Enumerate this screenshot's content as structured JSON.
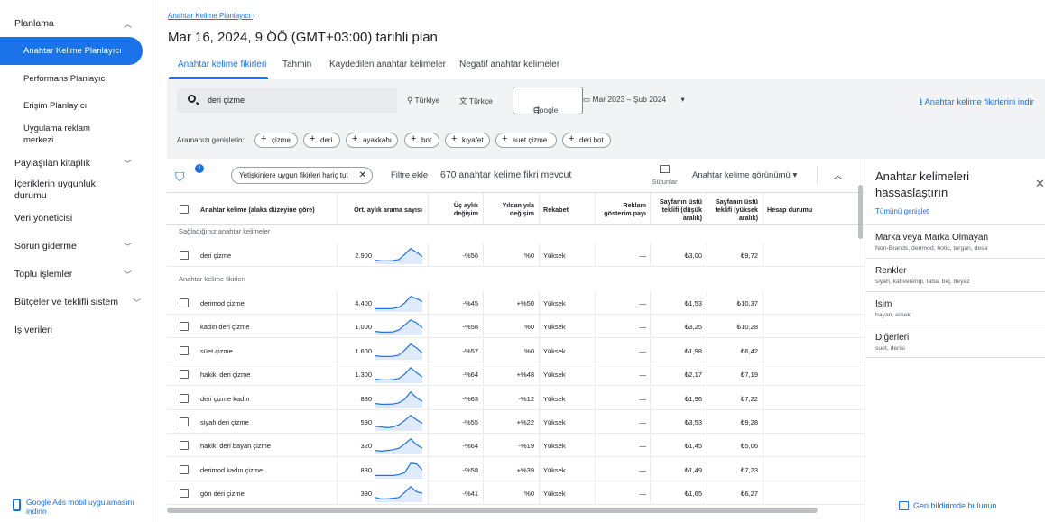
{
  "sidebar": {
    "planlama": "Planlama",
    "items": [
      {
        "label": "Anahtar Kelime Planlayıcı"
      },
      {
        "label": "Performans Planlayıcı"
      },
      {
        "label": "Erişim Planlayıcı"
      },
      {
        "label": "Uygulama reklam merkezi"
      }
    ],
    "groups": [
      {
        "label": "Paylaşılan kitaplık"
      },
      {
        "label": "İçeriklerin uygunluk durumu"
      },
      {
        "label": "Veri yöneticisi"
      },
      {
        "label": "Sorun giderme"
      },
      {
        "label": "Toplu işlemler"
      },
      {
        "label": "Bütçeler ve teklifli sistem"
      },
      {
        "label": "İş verileri"
      }
    ],
    "mobile_link": "Google Ads mobil uygulamasını indirin"
  },
  "header": {
    "breadcrumb": "Anahtar Kelime Planlayıcı",
    "breadcrumb_sep": "›",
    "title": "Mar 16, 2024, 9 ÖÖ (GMT+03:00) tarihli plan"
  },
  "tabs": [
    {
      "label": "Anahtar kelime fikirleri"
    },
    {
      "label": "Tahmin"
    },
    {
      "label": "Kaydedilen anahtar kelimeler"
    },
    {
      "label": "Negatif anahtar kelimeler"
    }
  ],
  "search": {
    "value": "deri çizme",
    "location": "Türkiye",
    "language": "Türkçe",
    "network": "Google",
    "date_range": "Mar 2023 – Şub 2024",
    "download": "Anahtar kelime fikirlerini indir"
  },
  "expand": {
    "label": "Aramanızı genişletin:",
    "chips": [
      "çizme",
      "deri",
      "ayakkabı",
      "bot",
      "kıyafet",
      "suet çizme",
      "deri bot"
    ]
  },
  "table_toolbar": {
    "filter_badge": "1",
    "adult_chip": "Yetişkinlere uygun fikirleri hariç tut",
    "add_filter": "Filtre ekle",
    "ideas_count": "670 anahtar kelime fikri mevcut",
    "columns": "Sütunlar",
    "view": "Anahtar kelime görünümü",
    "view_arrow": "▾"
  },
  "columns": {
    "keyword": "Anahtar kelime (alaka düzeyine göre)",
    "avg": "Ort. aylık arama sayısı",
    "three_month": "Üç aylık değişim",
    "yoy": "Yıldan yıla değişim",
    "competition": "Rekabet",
    "impr_share": "Reklam gösterim payı",
    "bid_low": "Sayfanın üstü teklifi (düşük aralık)",
    "bid_high": "Sayfanın üstü teklifi (yüksek aralık)",
    "account": "Hesap durumu"
  },
  "sections": {
    "provided": "Sağladığınız anahtar kelimeler",
    "ideas": "Anahtar kelime fikirleri"
  },
  "provided_rows": [
    {
      "keyword": "deri çizme",
      "avg": "2.900",
      "three_month": "-%56",
      "yoy": "%0",
      "competition": "Yüksek",
      "impr": "—",
      "low": "₺3,00",
      "high": "₺9,72",
      "trend": [
        0.15,
        0.1,
        0.1,
        0.12,
        0.2,
        0.55,
        0.95,
        0.7,
        0.4
      ]
    }
  ],
  "idea_rows": [
    {
      "keyword": "derimod çizme",
      "avg": "4.400",
      "three_month": "-%45",
      "yoy": "+%50",
      "competition": "Yüksek",
      "impr": "—",
      "low": "₺1,53",
      "high": "₺10,37",
      "trend": [
        0.1,
        0.1,
        0.1,
        0.12,
        0.2,
        0.5,
        0.95,
        0.8,
        0.6
      ]
    },
    {
      "keyword": "kadın deri çizme",
      "avg": "1.000",
      "three_month": "-%58",
      "yoy": "%0",
      "competition": "Yüksek",
      "impr": "—",
      "low": "₺3,25",
      "high": "₺10,28",
      "trend": [
        0.15,
        0.1,
        0.1,
        0.12,
        0.25,
        0.6,
        0.95,
        0.75,
        0.4
      ]
    },
    {
      "keyword": "süet çizme",
      "avg": "1.600",
      "three_month": "-%57",
      "yoy": "%0",
      "competition": "Yüksek",
      "impr": "—",
      "low": "₺1,98",
      "high": "₺6,42",
      "trend": [
        0.15,
        0.1,
        0.1,
        0.12,
        0.2,
        0.55,
        0.95,
        0.7,
        0.35
      ]
    },
    {
      "keyword": "hakiki deri çizme",
      "avg": "1.300",
      "three_month": "-%64",
      "yoy": "+%48",
      "competition": "Yüksek",
      "impr": "—",
      "low": "₺2,17",
      "high": "₺7,19",
      "trend": [
        0.15,
        0.1,
        0.1,
        0.12,
        0.2,
        0.5,
        0.95,
        0.6,
        0.3
      ]
    },
    {
      "keyword": "deri çizme kadın",
      "avg": "880",
      "three_month": "-%63",
      "yoy": "-%12",
      "competition": "Yüksek",
      "impr": "—",
      "low": "₺1,96",
      "high": "₺7,22",
      "trend": [
        0.15,
        0.1,
        0.1,
        0.12,
        0.2,
        0.45,
        0.95,
        0.55,
        0.3
      ]
    },
    {
      "keyword": "siyah deri çizme",
      "avg": "590",
      "three_month": "-%55",
      "yoy": "+%22",
      "competition": "Yüksek",
      "impr": "—",
      "low": "₺3,53",
      "high": "₺9,28",
      "trend": [
        0.2,
        0.15,
        0.1,
        0.15,
        0.3,
        0.6,
        0.95,
        0.65,
        0.4
      ]
    },
    {
      "keyword": "hakiki deri bayan çizme",
      "avg": "320",
      "three_month": "-%64",
      "yoy": "-%19",
      "competition": "Yüksek",
      "impr": "—",
      "low": "₺1,45",
      "high": "₺5,06",
      "trend": [
        0.15,
        0.1,
        0.15,
        0.2,
        0.3,
        0.6,
        0.95,
        0.55,
        0.3
      ]
    },
    {
      "keyword": "derimod kadın çizme",
      "avg": "880",
      "three_month": "-%58",
      "yoy": "+%39",
      "competition": "Yüksek",
      "impr": "—",
      "low": "₺1,49",
      "high": "₺7,23",
      "trend": [
        0.1,
        0.1,
        0.1,
        0.1,
        0.15,
        0.3,
        0.95,
        0.9,
        0.5
      ]
    },
    {
      "keyword": "gön deri çizme",
      "avg": "390",
      "three_month": "-%41",
      "yoy": "%0",
      "competition": "Yüksek",
      "impr": "—",
      "low": "₺1,65",
      "high": "₺6,27",
      "trend": [
        0.2,
        0.1,
        0.1,
        0.15,
        0.2,
        0.55,
        0.95,
        0.6,
        0.5
      ]
    }
  ],
  "refine": {
    "title": "Anahtar kelimeleri hassaslaştırın",
    "expand_all": "Tümünü genişlet",
    "items": [
      {
        "title": "Marka veya Marka Olmayan",
        "sub": "Non-Brands, derimod, hotic, tergan, desa"
      },
      {
        "title": "Renkler",
        "sub": "siyah, kahverengi, taba, bej, beyaz"
      },
      {
        "title": "Isim",
        "sub": "bayan, erkek"
      },
      {
        "title": "Diğerleri",
        "sub": "suet, derisi"
      }
    ],
    "feedback": "Geri bildirimde bulunun"
  },
  "colors": {
    "accent": "#1a73e8",
    "spark": "#1a73e8"
  }
}
